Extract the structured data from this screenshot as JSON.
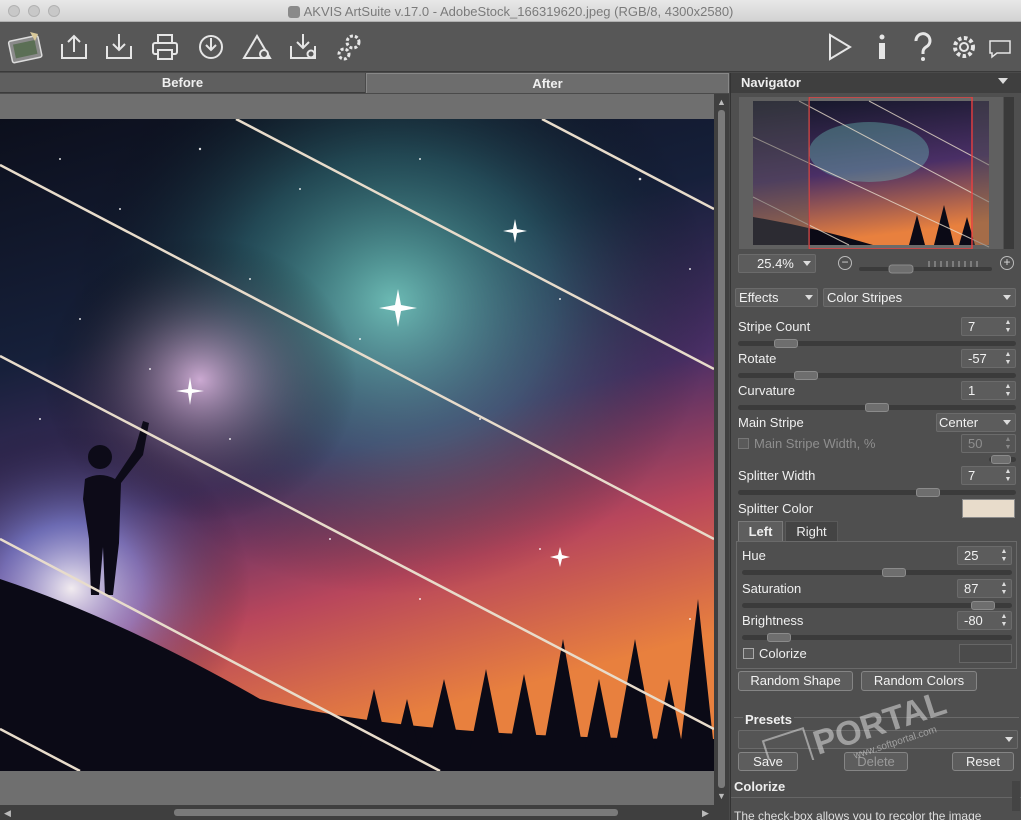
{
  "window": {
    "title": "AKVIS ArtSuite v.17.0 - AdobeStock_166319620.jpeg (RGB/8, 4300x2580)"
  },
  "toolbar": {
    "icons": [
      "artsuite-logo-icon",
      "open-icon",
      "save-icon",
      "print-icon",
      "share-icon",
      "batch-icon",
      "plugin-icon",
      "settings-gear-cluster-icon",
      "run-icon",
      "info-icon",
      "help-icon",
      "preferences-icon",
      "hints-icon"
    ]
  },
  "view_tabs": {
    "before": "Before",
    "after": "After"
  },
  "navigator": {
    "title": "Navigator",
    "zoom": "25.4%"
  },
  "effects": {
    "category": "Effects",
    "effect": "Color Stripes"
  },
  "params": {
    "stripe_count": {
      "label": "Stripe Count",
      "value": "7",
      "fraction": 0.14
    },
    "rotate": {
      "label": "Rotate",
      "value": "-57",
      "fraction": 0.22
    },
    "curvature": {
      "label": "Curvature",
      "value": "1",
      "fraction": 0.5
    },
    "main_stripe": {
      "label": "Main Stripe",
      "value": "Center"
    },
    "main_stripe_width": {
      "label": "Main Stripe Width, %",
      "value": "50"
    },
    "splitter_width": {
      "label": "Splitter Width",
      "value": "7",
      "fraction": 0.7
    },
    "splitter_color": {
      "label": "Splitter Color",
      "color": "#e8dccb"
    }
  },
  "side_tabs": {
    "left": "Left",
    "right": "Right"
  },
  "side_params": {
    "hue": {
      "label": "Hue",
      "value": "25",
      "fraction": 0.57
    },
    "saturation": {
      "label": "Saturation",
      "value": "87",
      "fraction": 0.93
    },
    "brightness": {
      "label": "Brightness",
      "value": "-80",
      "fraction": 0.1
    },
    "colorize": {
      "label": "Colorize"
    }
  },
  "buttons": {
    "random_shape": "Random Shape",
    "random_colors": "Random Colors"
  },
  "presets": {
    "title": "Presets",
    "save": "Save",
    "delete": "Delete",
    "reset": "Reset"
  },
  "help": {
    "title": "Colorize",
    "text": "The check-box allows you to recolor the image"
  },
  "watermark": {
    "text": "PORTAL",
    "url": "www.softportal.com"
  }
}
